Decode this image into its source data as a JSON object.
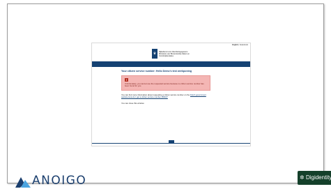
{
  "language": {
    "active": "English",
    "other": "Nederlands"
  },
  "org": {
    "name_lines": [
      "Rijksdienst voor Identiteitsgegevens",
      "Ministerie van Binnenlandse Zaken en",
      "Koninkrijksrelaties"
    ]
  },
  "page": {
    "heading": "Your citizen service number: Hello Demo's test werkponing",
    "alert_icon": "!",
    "alert_text": "Unfortunately, you cannot use the requested service because no citizen service number has been found for you.",
    "info_text": "You can find more information about requesting a citizen service number on the",
    "info_link": "Dutch government website How do I get a citizen service number (BSN)?",
    "close_text": "You can close this window."
  },
  "footer": {
    "brand": "ANOIGO",
    "badge": "Digidentity"
  },
  "colors": {
    "gov_blue": "#154273",
    "alert_bg": "#f4b6b4",
    "alert_icon": "#b52f22",
    "brand_navy": "#1b3f6e",
    "badge_green": "#14402a"
  }
}
